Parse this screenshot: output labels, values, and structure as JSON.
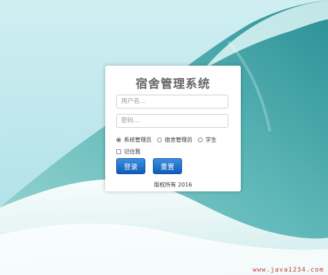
{
  "app_title": "宿舍管理系统",
  "login": {
    "username_placeholder": "用户名...",
    "password_placeholder": "密码...",
    "roles": [
      {
        "label": "系统管理员",
        "selected": true
      },
      {
        "label": "宿舍管理员",
        "selected": false
      },
      {
        "label": "学生",
        "selected": false
      }
    ],
    "remember_label": "记住我",
    "remember_checked": false,
    "login_button": "登录",
    "reset_button": "重置",
    "copyright": "版权所有 2016"
  },
  "watermark": "www.java1234.com",
  "colors": {
    "button": "#0f5cb8",
    "title": "#666666",
    "watermark": "#c0392b"
  }
}
